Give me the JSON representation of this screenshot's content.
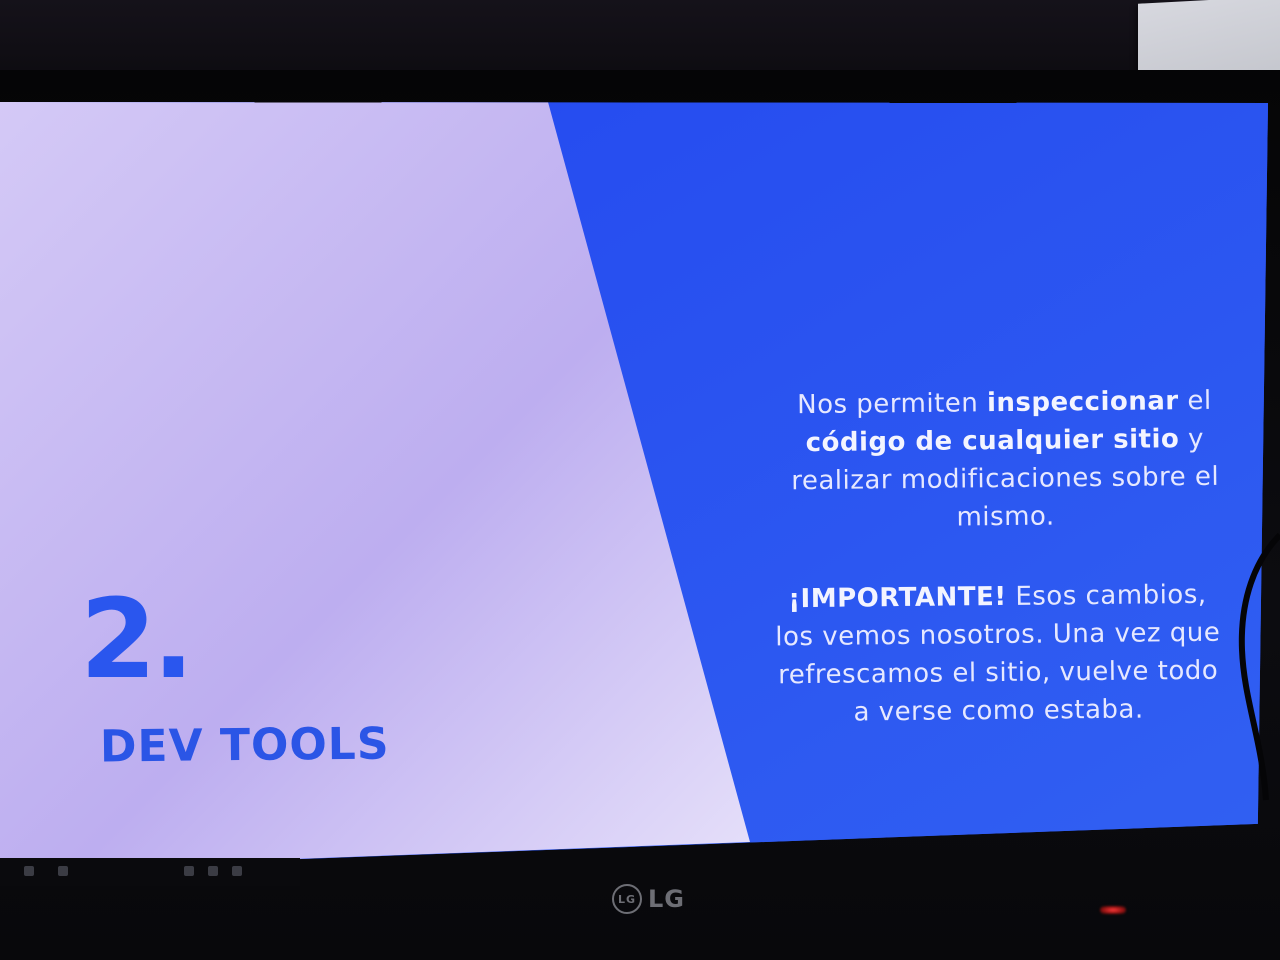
{
  "slide": {
    "number": "2.",
    "title": "DEV TOOLS",
    "paragraph1": {
      "part1": "Nos permiten ",
      "bold1": "inspeccionar",
      "part2": " el ",
      "bold2": "código de cualquier sitio",
      "part3": " y realizar modificaciones sobre el mismo."
    },
    "paragraph2": {
      "bold": "¡IMPORTANTE!",
      "text": " Esos cambios, los vemos nosotros. Una vez que refrescamos el sitio, vuelve todo a verse como estaba."
    }
  },
  "monitor": {
    "brand": "LG",
    "brand_circle_text": "LG"
  },
  "colors": {
    "left_panel": "#bfb0ef",
    "right_panel": "#2a4ef0",
    "accent_text": "#2a56ee",
    "body_text": "#e6e8ff"
  }
}
